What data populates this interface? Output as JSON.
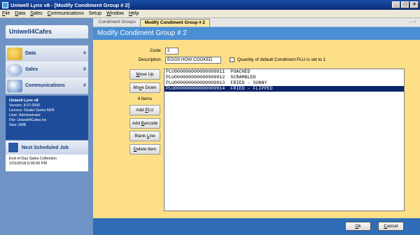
{
  "window": {
    "title": "Uniwell Lynx v8 - [Modify Condiment Group # 2]",
    "min": "_",
    "max": "□",
    "close": "×"
  },
  "menu": [
    {
      "label": "File",
      "key": "F",
      "rest": "ile"
    },
    {
      "label": "Data",
      "key": "D",
      "rest": "ata"
    },
    {
      "label": "Sales",
      "key": "S",
      "rest": "ales"
    },
    {
      "label": "Communications",
      "key": "C",
      "rest": "ommunications"
    },
    {
      "label": "Setup",
      "key": "",
      "rest": "Setup"
    },
    {
      "label": "Window",
      "key": "W",
      "rest": "indow"
    },
    {
      "label": "Help",
      "key": "H",
      "rest": "elp"
    }
  ],
  "sidebar": {
    "header": "Uniwell4Cafes",
    "panels": [
      {
        "label": "Data",
        "icon": "data-folder-icon",
        "chevron": "¥"
      },
      {
        "label": "Sales",
        "icon": "sales-icon",
        "chevron": "¥"
      },
      {
        "label": "Communications",
        "icon": "communications-icon",
        "chevron": "¥"
      }
    ],
    "info": {
      "title": "Uniwell Lynx v8",
      "version": "Version: 8.07.0006",
      "licence": "Licence: Dealer Demo NFR",
      "user": "User: Administrator",
      "file": "File: Uniwell4Cafes.lnx",
      "size": "Size: 6MB"
    },
    "next_job": {
      "title": "Next Scheduled Job",
      "line1": "End of Day Sales Collection",
      "line2": "1/01/2018 6:00:00 PM"
    }
  },
  "tabs": [
    {
      "label": "Condiment Groups",
      "active": false
    },
    {
      "label": "Modify Condiment Group # 2",
      "active": true
    }
  ],
  "tab_controls": "‹ › ×",
  "form": {
    "title": "Modify Condiment Group # 2",
    "code_label": "Code:",
    "code_value": "2",
    "description_label": "Description:",
    "description_value": "EGGS HOW COOKED",
    "checkbox_label": "Quantity of default Condiment PLU is set to 1",
    "checkbox_checked": false,
    "buttons": {
      "move_up": {
        "key": "M",
        "rest": "ove Up"
      },
      "move_down": {
        "pre": "Mo",
        "key": "v",
        "rest": "e Down"
      },
      "items_count": "4 Items",
      "add_plu": {
        "pre": "Add ",
        "key": "P",
        "rest": "LU"
      },
      "add_barcode": {
        "pre": "Add ",
        "key": "B",
        "rest": "arcode"
      },
      "blank_line": {
        "pre": "Blank ",
        "key": "L",
        "rest": "ine"
      },
      "delete_item": {
        "key": "D",
        "rest": "elete Item"
      }
    },
    "list_items": [
      {
        "text": "PLU000000000000009911  POACHED",
        "selected": false
      },
      {
        "text": "PLU000000000000009912  SCRAMBLED",
        "selected": false
      },
      {
        "text": "PLU000000000000009913  FRIED - SUNNY",
        "selected": false
      },
      {
        "text": "PLU000000000000009914  FRIED - FLIPPED",
        "selected": true
      }
    ]
  },
  "footer": {
    "ok": {
      "key": "O",
      "rest": "k"
    },
    "cancel": {
      "key": "C",
      "rest": "ancel"
    }
  }
}
